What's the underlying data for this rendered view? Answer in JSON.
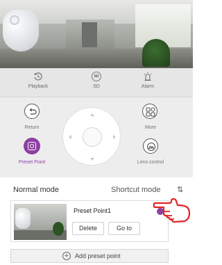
{
  "toolbar": {
    "playback_label": "Playback",
    "sd_label": "SD",
    "sd_icon_text": "SD",
    "alarm_label": "Alarm"
  },
  "controls": {
    "return_label": "Return",
    "more_label": "More",
    "preset_point_label": "Preset Point",
    "lens_control_label": "Lens control"
  },
  "mode": {
    "title": "Normal mode",
    "switch_label": "Shortcut mode",
    "swap_icon": "⇅"
  },
  "preset": {
    "name": "Preset Point1",
    "delete_label": "Delete",
    "goto_label": "Go to"
  },
  "add": {
    "icon": "+",
    "label": "Add preset point"
  },
  "colors": {
    "accent": "#8e3fa3",
    "hand_pointer": "#e02626"
  }
}
